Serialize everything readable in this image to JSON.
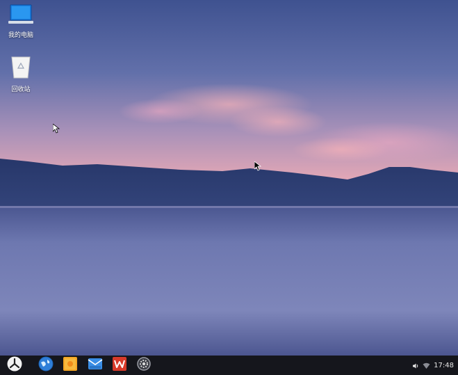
{
  "desktop": {
    "icons": [
      {
        "label": "我的电脑",
        "icon": "computer-icon"
      },
      {
        "label": "回收站",
        "icon": "trash-icon"
      }
    ]
  },
  "taskbar": {
    "start_icon": "start-menu-icon",
    "apps": [
      {
        "icon": "browser-icon"
      },
      {
        "icon": "file-manager-icon"
      },
      {
        "icon": "mail-icon"
      },
      {
        "icon": "wps-office-icon"
      },
      {
        "icon": "settings-icon"
      }
    ],
    "tray": {
      "volume_icon": "volume-icon",
      "network_icon": "wifi-icon",
      "time": "17:48"
    }
  },
  "colors": {
    "taskbar": "#15161c",
    "sky_top": "#4c5d98",
    "horizon_glow": "#e8a8b4",
    "mountains": "#2a3a6a",
    "water": "#6a74ae"
  }
}
